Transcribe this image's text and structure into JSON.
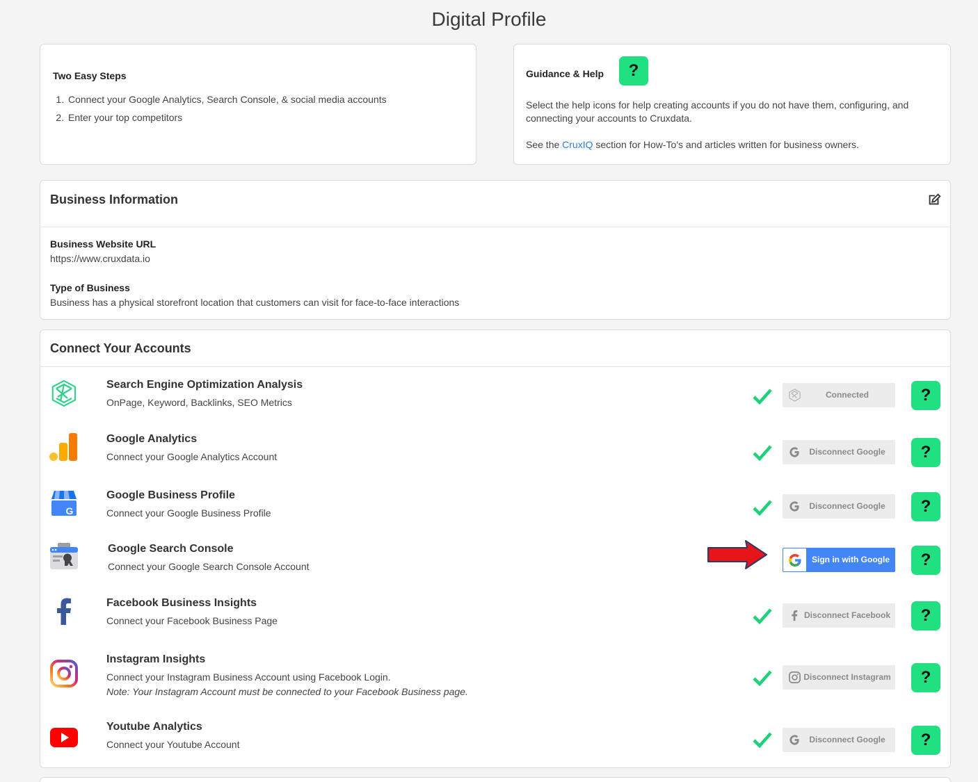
{
  "page": {
    "title": "Digital Profile"
  },
  "steps": {
    "title": "Two Easy Steps",
    "items": [
      "Connect your Google Analytics, Search Console, & social media accounts",
      "Enter your top competitors"
    ]
  },
  "help": {
    "title": "Guidance & Help",
    "button_label": "?",
    "p1": "Select the help icons for help creating accounts if you do not have them, configuring, and connecting your accounts to Cruxdata.",
    "p2_before": "See the ",
    "p2_link": "CruxIQ",
    "p2_after": " section for How-To's and articles written for business owners."
  },
  "business": {
    "title": "Business Information",
    "url_label": "Business Website URL",
    "url_value": "https://www.cruxdata.io",
    "type_label": "Type of Business",
    "type_value": "Business has a physical storefront location that customers can visit for face-to-face interactions"
  },
  "accounts": {
    "title": "Connect Your Accounts",
    "help_label": "?",
    "rows": [
      {
        "title": "Search Engine Optimization Analysis",
        "desc": "OnPage, Keyword, Backlinks, SEO Metrics",
        "button": "Connected",
        "icon": "cruxdata-icon",
        "connected": true
      },
      {
        "title": "Google Analytics",
        "desc": "Connect your Google Analytics Account",
        "button": "Disconnect Google",
        "icon": "google-analytics-icon",
        "connected": true
      },
      {
        "title": "Google Business Profile",
        "desc": "Connect your Google Business Profile",
        "button": "Disconnect Google",
        "icon": "google-business-icon",
        "connected": true
      },
      {
        "title": "Google Search Console",
        "desc": "Connect your Google Search Console Account",
        "button": "Sign in with Google",
        "icon": "search-console-icon",
        "connected": false
      },
      {
        "title": "Facebook Business Insights",
        "desc": "Connect your Facebook Business Page",
        "button": "Disconnect Facebook",
        "icon": "facebook-icon",
        "connected": true
      },
      {
        "title": "Instagram Insights",
        "desc": "Connect your Instagram Business Account using Facebook Login.",
        "note": "Note: Your Instagram Account must be connected to your Facebook Business page.",
        "button": "Disconnect Instagram",
        "icon": "instagram-icon",
        "connected": true
      },
      {
        "title": "Youtube Analytics",
        "desc": "Connect your Youtube Account",
        "button": "Disconnect Google",
        "icon": "youtube-icon",
        "connected": true
      }
    ]
  },
  "colors": {
    "accent_green": "#21e081",
    "check_green": "#1fd17a",
    "google_blue": "#4285f4",
    "link_blue": "#2f7de1",
    "arrow_red": "#e5151a"
  }
}
